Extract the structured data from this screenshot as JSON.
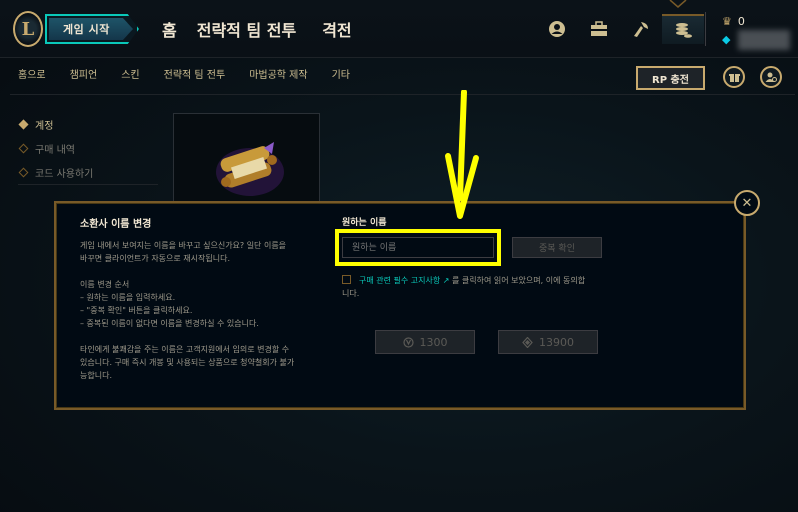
{
  "header": {
    "logo_letter": "L",
    "play_button": "게임 시작",
    "nav": [
      "홈",
      "전략적 팀 전투",
      "격전"
    ],
    "icons": [
      "profile-icon",
      "collection-icon",
      "loot-icon",
      "store-icon"
    ],
    "currency": {
      "rp": "0",
      "be": ""
    }
  },
  "subnav": {
    "items": [
      "홈으로",
      "챔피언",
      "스킨",
      "전략적 팀 전투",
      "마법공학 제작",
      "기타"
    ],
    "rp_button": "RP 충전"
  },
  "sidebar": {
    "items": [
      {
        "label": "계정",
        "active": true
      },
      {
        "label": "구매 내역",
        "active": false
      },
      {
        "label": "코드 사용하기",
        "active": false
      }
    ]
  },
  "modal": {
    "title": "소환사 이름 변경",
    "desc_intro": [
      "게임 내에서 보여지는 이름을 바꾸고 싶으신가요? 일단 이름을",
      "바꾸면 클라이언트가 자동으로 재시작됩니다."
    ],
    "desc_steps_title": "이름 변경 순서",
    "desc_steps": [
      "– 원하는 이름을 입력하세요.",
      "– \"중복 확인\" 버튼을 클릭하세요.",
      "– 중복된 이름이 없다면 이름을 변경하실 수 있습니다."
    ],
    "desc_warning": [
      "타인에게 불쾌감을 주는 이름은 고객지원에서 임의로 변경할 수",
      "있습니다. 구매 즉시 개봉 및 사용되는 상품으로 청약철회가 불가",
      "능합니다."
    ],
    "field_label": "원하는 이름",
    "input_placeholder": "원하는 이름",
    "check_button": "중복 확인",
    "agree_link": "구매 관련 필수 고지사항 ↗",
    "agree_text": "를 클릭하여 읽어 보았으며, 이에 동의합",
    "agree_text2": "니다.",
    "price_rp": "1300",
    "price_be": "13900",
    "close": "✕"
  },
  "colors": {
    "gold": "#c8aa6e",
    "teal": "#0ac8b9",
    "highlight": "#ffff00"
  }
}
